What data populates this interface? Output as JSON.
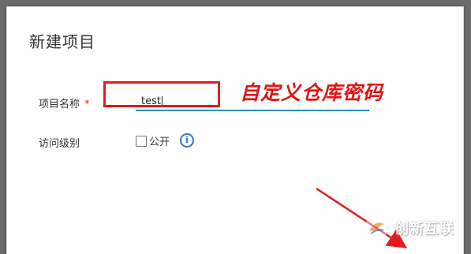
{
  "dialog": {
    "title": "新建项目"
  },
  "form": {
    "project_name_label": "项目名称",
    "required_marker": "*",
    "project_name_value": "test",
    "access_level_label": "访问级别",
    "public_checkbox_label": "公开",
    "public_checked": false,
    "info_icon": "info-icon"
  },
  "annotation": {
    "text": "自定义仓库密码",
    "color": "#e01515"
  },
  "watermark": {
    "text": "创新互联"
  },
  "colors": {
    "input_underline": "#2b8fce",
    "highlight_box": "#e21c1c",
    "arrow": "#e21c1c",
    "info_icon": "#2f79bf"
  }
}
